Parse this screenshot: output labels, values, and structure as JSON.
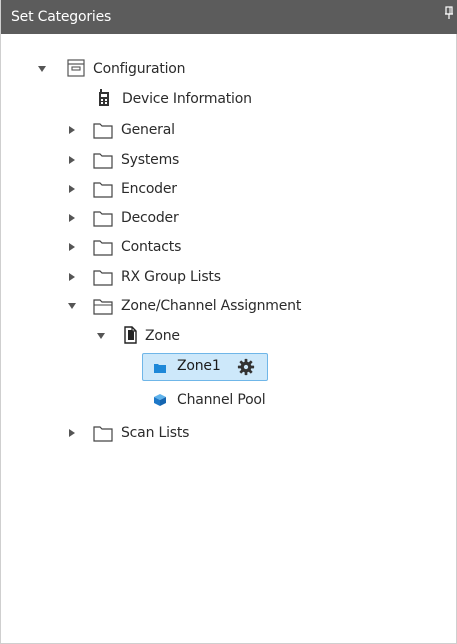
{
  "panel": {
    "title": "Set Categories"
  },
  "tree": {
    "configuration": "Configuration",
    "device_information": "Device Information",
    "general": "General",
    "systems": "Systems",
    "encoder": "Encoder",
    "decoder": "Decoder",
    "contacts": "Contacts",
    "rx_group_lists": "RX Group Lists",
    "zone_channel_assignment": "Zone/Channel Assignment",
    "zone": "Zone",
    "zone1": "Zone1",
    "channel_pool": "Channel Pool",
    "scan_lists": "Scan Lists"
  },
  "colors": {
    "titlebar_bg": "#5c5c5c",
    "selection_bg": "#cde8fa",
    "selection_border": "#6fb6e8",
    "accent_blue": "#1e88d8"
  },
  "icons": {
    "pin": "pin-icon",
    "config": "config-box-icon",
    "device": "radio-device-icon",
    "folder": "folder-icon",
    "open_folder": "folder-open-icon",
    "document": "document-icon",
    "zone_folder": "blue-folder-icon",
    "gear": "gear-icon",
    "cube": "cube-icon"
  }
}
